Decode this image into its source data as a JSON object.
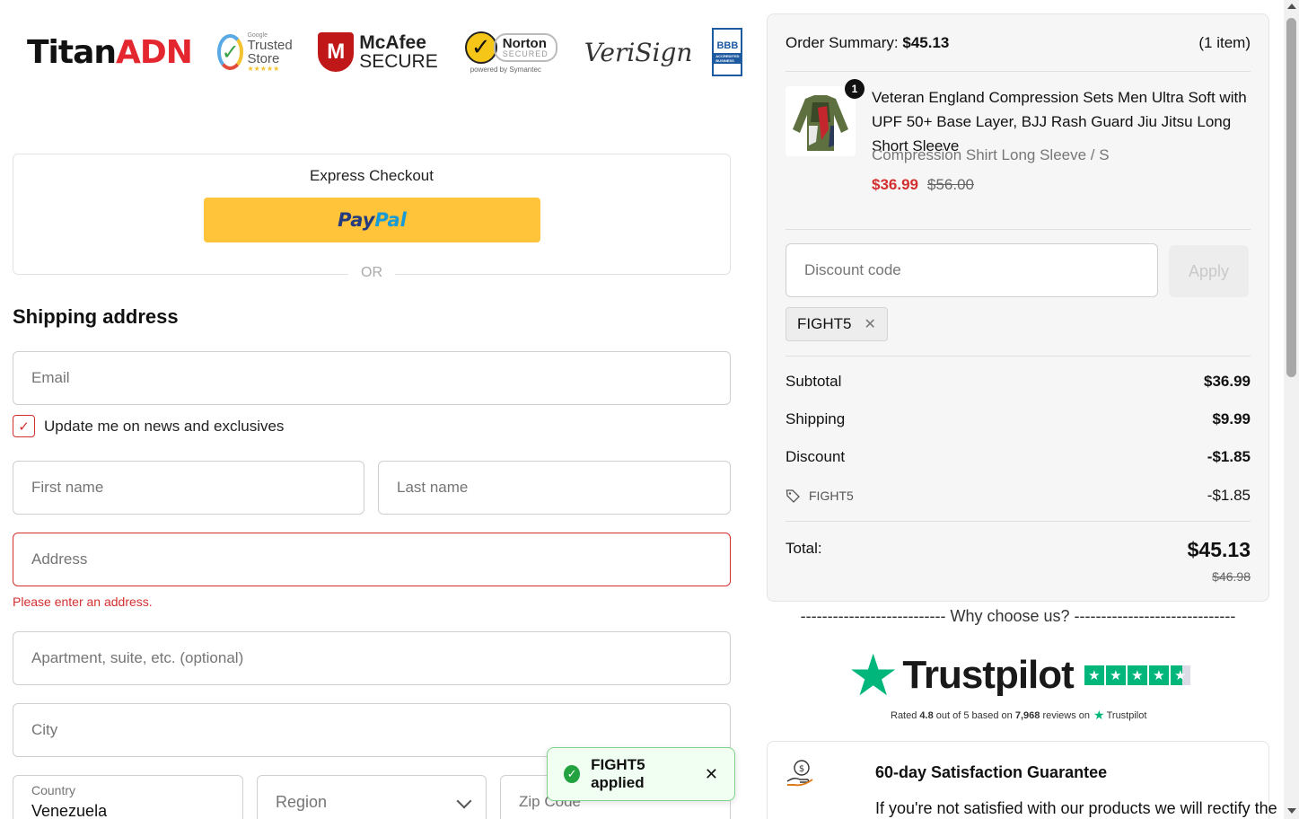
{
  "logos": {
    "titan_a": "Titan",
    "titan_b": "ADN",
    "trusted_small": "Google",
    "trusted_big": "Trusted Store",
    "trusted_stars": "★★★★★",
    "mcafee_a": "McAfee",
    "mcafee_b": "SECURE",
    "norton_a": "Norton",
    "norton_b": "SECURED",
    "norton_by": "powered by Symantec",
    "verisign": "VeriSign",
    "bbb": "BBB",
    "bbb_cap": "ACCREDITED BUSINESS"
  },
  "express": {
    "title": "Express Checkout",
    "paypal_pay": "Pay",
    "paypal_pal": "Pal",
    "or": "OR"
  },
  "shipping": {
    "title": "Shipping address",
    "email_placeholder": "Email",
    "newsletter_label": "Update me on news and exclusives",
    "first_name_placeholder": "First name",
    "last_name_placeholder": "Last name",
    "address_placeholder": "Address",
    "address_error": "Please enter an address.",
    "apartment_placeholder": "Apartment, suite, etc. (optional)",
    "city_placeholder": "City",
    "country_label": "Country",
    "country_value": "Venezuela",
    "region_placeholder": "Region",
    "zip_placeholder": "Zip Code"
  },
  "toast": {
    "text": "FIGHT5 applied",
    "close": "✕"
  },
  "summary": {
    "label": "Order Summary:",
    "amount": "$45.13",
    "items": "(1 item)",
    "product": {
      "qty": "1",
      "title": "Veteran England Compression Sets Men Ultra Soft with UPF 50+ Base Layer, BJJ Rash Guard Jiu Jitsu Long Short Sleeve",
      "variant": "Compression Shirt Long Sleeve / S",
      "price": "$36.99",
      "compare_price": "$56.00"
    },
    "discount_placeholder": "Discount code",
    "apply_label": "Apply",
    "applied_code": "FIGHT5",
    "subtotal_label": "Subtotal",
    "subtotal_value": "$36.99",
    "shipping_label": "Shipping",
    "shipping_value": "$9.99",
    "discount_label": "Discount",
    "discount_value": "-$1.85",
    "code_line_label": "FIGHT5",
    "code_line_value": "-$1.85",
    "total_label": "Total:",
    "total_value": "$45.13",
    "total_old": "$46.98"
  },
  "why": {
    "heading": "--------------------------- Why choose us? ------------------------------",
    "trustpilot": "Trustpilot",
    "rated_prefix": "Rated",
    "rating": "4.8",
    "rated_mid": "out of 5 based on",
    "reviews": "7,968",
    "rated_suffix": "reviews on",
    "tp_small": "Trustpilot"
  },
  "guarantee": {
    "title": "60-day Satisfaction Guarantee",
    "text": "If you're not satisfied with our products we will rectify the"
  },
  "colors": {
    "accent_red": "#d32f2f",
    "paypal_yellow": "#ffc439",
    "trustpilot_green": "#00b67a"
  }
}
